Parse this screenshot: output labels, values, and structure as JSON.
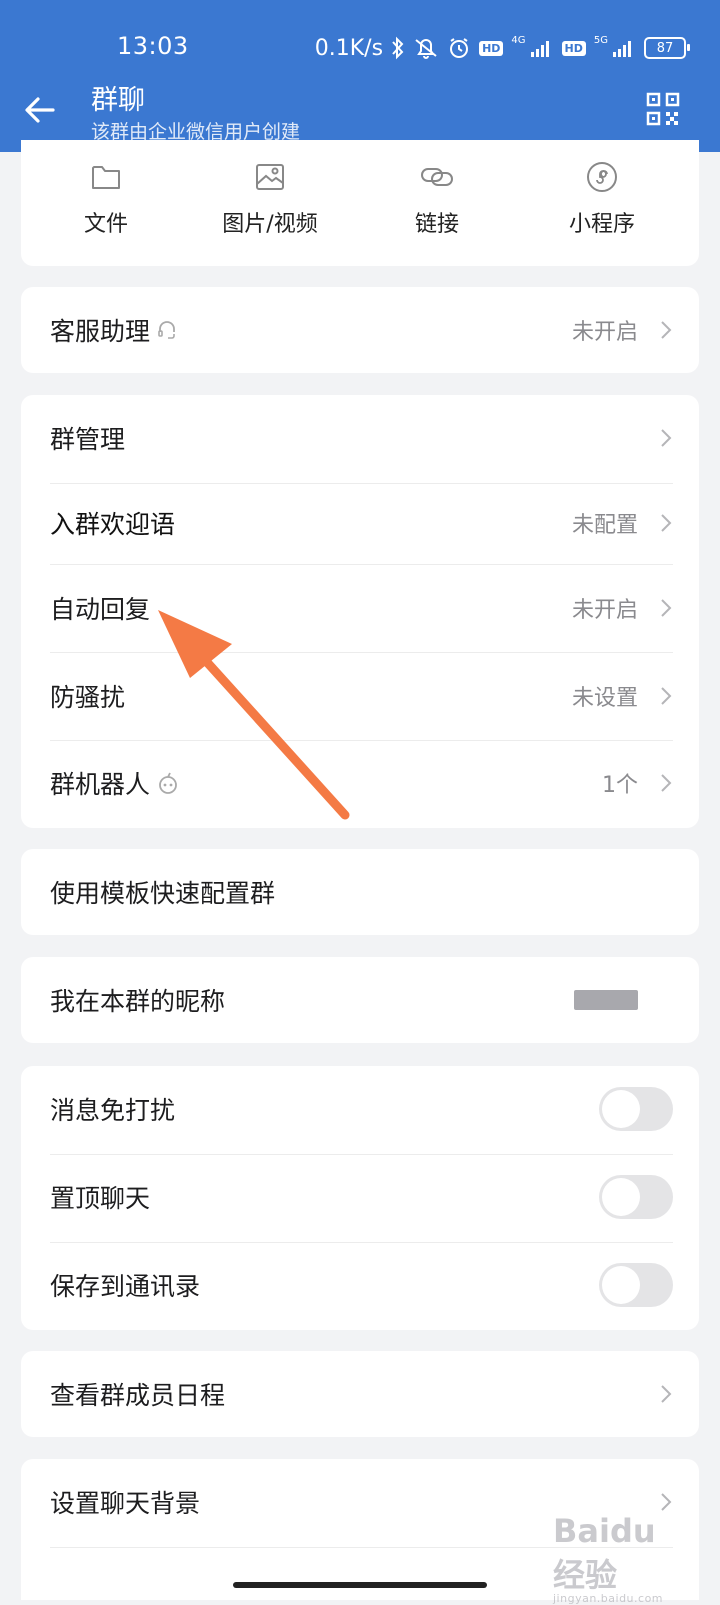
{
  "status_bar": {
    "time": "13:03",
    "net_speed": "0.1K/s",
    "hd_badge": "HD",
    "net_4g": "4G",
    "net_5g": "5G",
    "battery": "87"
  },
  "nav": {
    "title": "群聊",
    "subtitle": "该群由企业微信用户创建"
  },
  "media_tabs": [
    {
      "label": "文件",
      "icon": "folder-icon"
    },
    {
      "label": "图片/视频",
      "icon": "image-icon"
    },
    {
      "label": "链接",
      "icon": "link-icon"
    },
    {
      "label": "小程序",
      "icon": "mini-program-icon"
    }
  ],
  "customer_service": {
    "label": "客服助理",
    "value": "未开启"
  },
  "group_settings": [
    {
      "label": "群管理",
      "value": ""
    },
    {
      "label": "入群欢迎语",
      "value": "未配置"
    },
    {
      "label": "自动回复",
      "value": "未开启"
    },
    {
      "label": "防骚扰",
      "value": "未设置"
    },
    {
      "label": "群机器人",
      "value": "1个"
    }
  ],
  "template_config": {
    "label": "使用模板快速配置群"
  },
  "nickname": {
    "label": "我在本群的昵称"
  },
  "toggles": [
    {
      "label": "消息免打扰",
      "on": false
    },
    {
      "label": "置顶聊天",
      "on": false
    },
    {
      "label": "保存到通讯录",
      "on": false
    }
  ],
  "member_schedule": {
    "label": "查看群成员日程"
  },
  "chat_background": {
    "label": "设置聊天背景"
  },
  "watermark": {
    "brand": "Baidu经验",
    "url": "jingyan.baidu.com"
  },
  "colors": {
    "header": "#3b78d1",
    "annotation_arrow": "#f47a45"
  }
}
